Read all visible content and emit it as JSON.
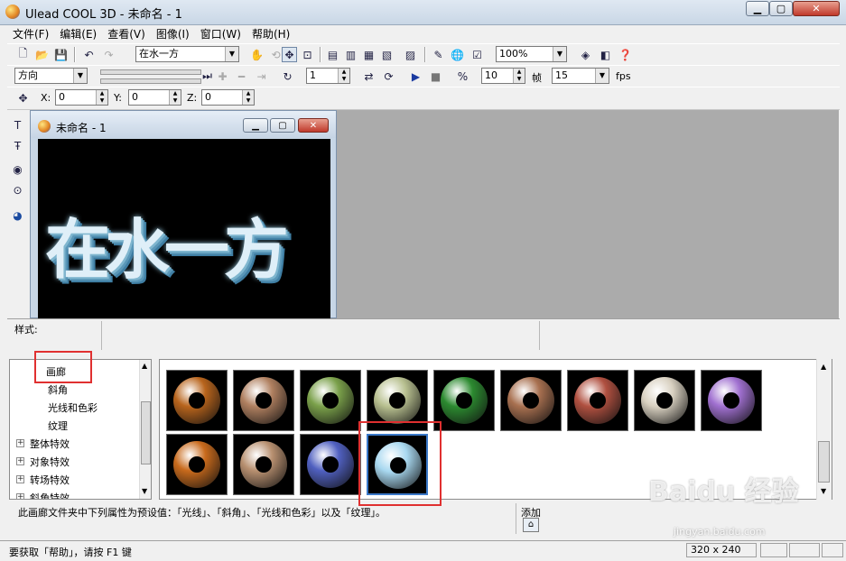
{
  "window": {
    "title": "Ulead COOL 3D - 未命名 - 1"
  },
  "menu": [
    "文件(F)",
    "编辑(E)",
    "查看(V)",
    "图像(I)",
    "窗口(W)",
    "帮助(H)"
  ],
  "toolbar1": {
    "text_combo": "在水一方",
    "zoom": "100%"
  },
  "toolbar2": {
    "direction": "方向",
    "frame": "1",
    "value": "10",
    "frame_unit": "帧",
    "fps_value": "15",
    "fps_label": "fps"
  },
  "toolbar3": {
    "x_label": "X:",
    "x_value": "0",
    "y_label": "Y:",
    "y_value": "0",
    "z_label": "Z:",
    "z_value": "0"
  },
  "document": {
    "title": "未命名 - 1",
    "canvas_text": "在水一方"
  },
  "style_panel": {
    "label": "样式:"
  },
  "tree": {
    "nodes": [
      {
        "label": "画廊",
        "level": 2,
        "expander": ""
      },
      {
        "label": "斜角",
        "level": 2,
        "expander": ""
      },
      {
        "label": "光线和色彩",
        "level": 2,
        "expander": ""
      },
      {
        "label": "纹理",
        "level": 2,
        "expander": ""
      },
      {
        "label": "整体特效",
        "level": 1,
        "expander": "+"
      },
      {
        "label": "对象特效",
        "level": 1,
        "expander": "+"
      },
      {
        "label": "转场特效",
        "level": 1,
        "expander": "+"
      },
      {
        "label": "斜角特效",
        "level": 1,
        "expander": "+"
      }
    ]
  },
  "gallery": {
    "colors": [
      "#b8641c",
      "#b08060",
      "#7aa04a",
      "#b8c090",
      "#2c8a30",
      "#a87050",
      "#b05040",
      "#d8d0c0",
      "#a070d0",
      "#c86a1c",
      "#b89070",
      "#5060c0",
      "#a8d8f0"
    ]
  },
  "description": {
    "text": "此画廊文件夹中下列属性为预设值：「光线」、「斜角」、「光线和色彩」以及「纹理」。",
    "add_label": "添加"
  },
  "status": {
    "help": "要获取「帮助」，请按 F1 键",
    "size": "320 x 240"
  },
  "watermark": {
    "main": "Baidu 经验",
    "sub": "jingyan.baidu.com"
  }
}
